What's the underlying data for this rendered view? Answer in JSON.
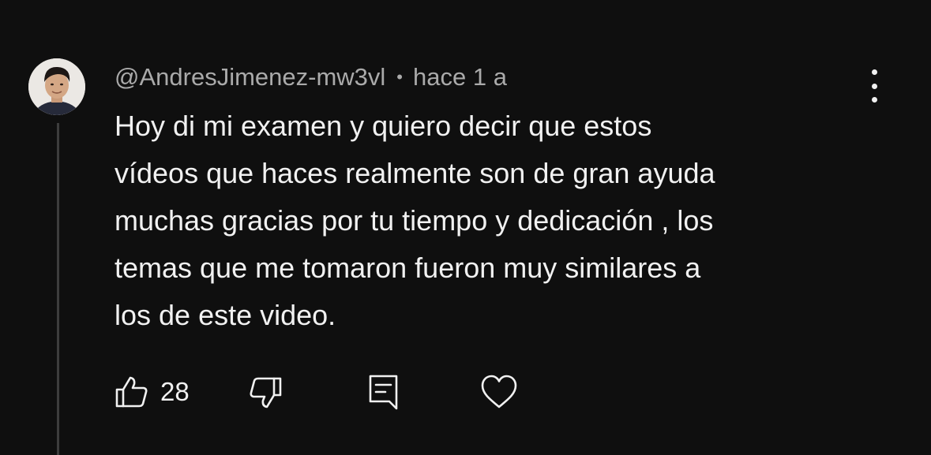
{
  "comment": {
    "author": "@AndresJimenez-mw3vl",
    "separator": "•",
    "timestamp": "hace 1 a",
    "text": "Hoy di mi examen y quiero decir que estos\nvídeos que haces  realmente son de gran ayuda\nmuchas gracias por tu tiempo y dedicación , los\ntemas que me tomaron fueron muy similares a\nlos de este video.",
    "like_count": "28"
  },
  "icons": {
    "avatar": "avatar",
    "more": "more-vertical-icon",
    "like": "thumbs-up-icon",
    "dislike": "thumbs-down-icon",
    "reply": "reply-icon",
    "heart": "heart-icon"
  },
  "colors": {
    "background": "#0f0f0f",
    "text_primary": "#f1f1f1",
    "text_secondary": "#aaaaaa",
    "thread_line": "#3d3d3d"
  }
}
